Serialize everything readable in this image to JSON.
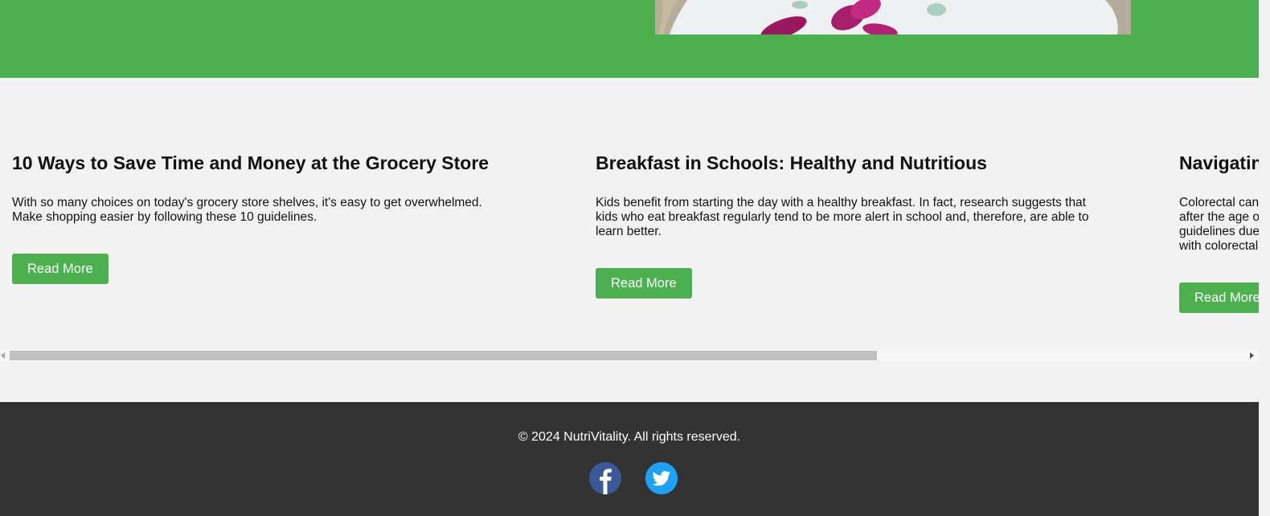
{
  "articles": [
    {
      "title": "10 Ways to Save Time and Money at the Grocery Store",
      "summary": "With so many choices on today's grocery store shelves, it's easy to get overwhelmed. Make shopping easier by following these 10 guidelines.",
      "button": "Read More"
    },
    {
      "title": "Breakfast in Schools: Healthy and Nutritious",
      "summary": "Kids benefit from starting the day with a healthy breakfast. In fact, research suggests that kids who eat breakfast regularly tend to be more alert in school and, therefore, are able to learn better.",
      "button": "Read More"
    },
    {
      "title": "Navigatin and Lifes",
      "summary": "Colorectal can after the age o guidelines due with colorectal",
      "button": "Read More"
    }
  ],
  "footer": {
    "copyright": "© 2024 NutriVitality. All rights reserved."
  },
  "socials": [
    "facebook-icon",
    "twitter-icon"
  ],
  "colors": {
    "brand_green": "#4caf50",
    "footer_bg": "#333333",
    "facebook": "#3b5998",
    "twitter": "#1da1f2"
  }
}
